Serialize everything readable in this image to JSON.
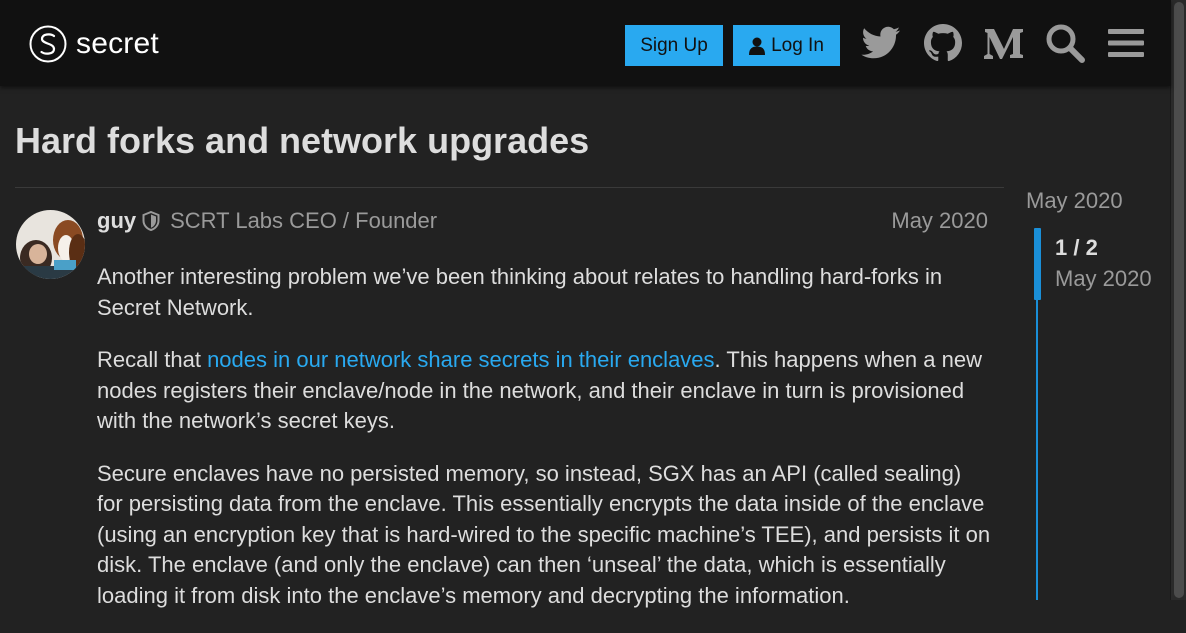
{
  "header": {
    "logo_text": "secret",
    "signup_label": "Sign Up",
    "login_label": "Log In",
    "icons": [
      "twitter-icon",
      "github-icon",
      "medium-icon",
      "search-icon",
      "menu-icon"
    ]
  },
  "topic": {
    "title": "Hard forks and network upgrades"
  },
  "post": {
    "username": "guy",
    "user_title": "SCRT Labs CEO / Founder",
    "date": "May 2020",
    "p1": "Another interesting problem we’ve been thinking about relates to handling hard-forks in Secret Network.",
    "p2_before": "Recall that ",
    "p2_link": "nodes in our network share secrets in their enclaves",
    "p2_after": ". This happens when a new nodes registers their enclave/node in the network, and their enclave in turn is provisioned with the network’s secret keys.",
    "p3": "Secure enclaves have no persisted memory, so instead, SGX has an API (called sealing) for persisting data from the enclave. This essentially encrypts the data inside of the enclave (using an encryption key that is hard-wired to the specific machine’s TEE), and persists it on disk. The enclave (and only the enclave) can then ‘unseal’ the data, which is essentially loading it from disk into the enclave’s memory and decrypting the information."
  },
  "timeline": {
    "start_date": "May 2020",
    "position": "1 / 2",
    "current_date": "May 2020"
  },
  "colors": {
    "accent": "#29a9f0",
    "background": "#222222",
    "header_bg": "#111111"
  }
}
